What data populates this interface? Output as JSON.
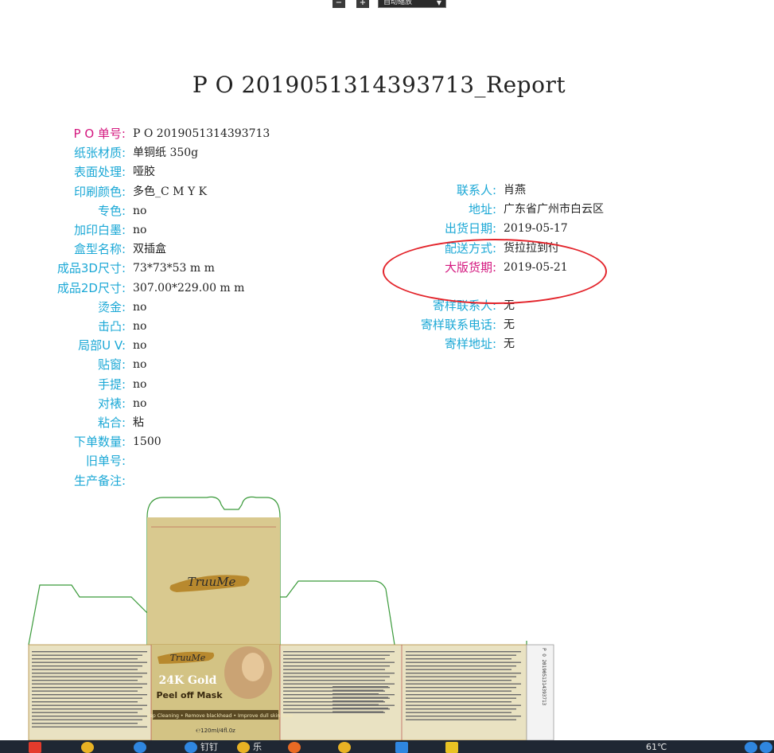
{
  "toolbar": {
    "minus_label": "−",
    "plus_label": "+",
    "zoom_value": "自动缩放"
  },
  "report": {
    "title": "P O 2019051314393713_Report",
    "left_fields": [
      {
        "label": "P O 单号:",
        "value": "P O 2019051314393713",
        "label_color": "pink"
      },
      {
        "label": "纸张材质:",
        "value": "单铜纸 350g"
      },
      {
        "label": "表面处理:",
        "value": "哑胶"
      },
      {
        "label": "印刷颜色:",
        "value": "多色_C M Y K"
      },
      {
        "label": "专色:",
        "value": "no"
      },
      {
        "label": "加印白墨:",
        "value": "no"
      },
      {
        "label": "盒型名称:",
        "value": "双插盒"
      },
      {
        "label": "成品3D尺寸:",
        "value": "73*73*53 m m"
      },
      {
        "label": "成品2D尺寸:",
        "value": "307.00*229.00 m m"
      },
      {
        "label": "烫金:",
        "value": "no"
      },
      {
        "label": "击凸:",
        "value": "no"
      },
      {
        "label": "局部U V:",
        "value": "no"
      },
      {
        "label": "贴窗:",
        "value": "no"
      },
      {
        "label": "手提:",
        "value": "no"
      },
      {
        "label": "对裱:",
        "value": "no"
      },
      {
        "label": "粘合:",
        "value": "粘"
      },
      {
        "label": "下单数量:",
        "value": "1500"
      },
      {
        "label": "旧单号:",
        "value": ""
      },
      {
        "label": "生产备注:",
        "value": ""
      }
    ],
    "right_fields": [
      {
        "label": "联系人:",
        "value": "肖燕"
      },
      {
        "label": "地址:",
        "value": "广东省广州市白云区"
      },
      {
        "label": "出货日期:",
        "value": "2019-05-17"
      },
      {
        "label": "配送方式:",
        "value": "货拉拉到付"
      },
      {
        "label": "大版货期:",
        "value": "2019-05-21",
        "label_color": "pink"
      },
      {
        "label": "寄样联系人:",
        "value": "无"
      },
      {
        "label": "寄样联系电话:",
        "value": "无"
      },
      {
        "label": "寄样地址:",
        "value": "无"
      }
    ]
  },
  "artwork": {
    "brand": "TruuMe",
    "product_line1": "24K Gold",
    "product_line2": "Peel off Mask",
    "features": "• Deep Cleaning • Remove blackhead • Improve dull skin tone",
    "volume": "℮120ml/4fl.0z",
    "side_code": "P O 2019051314393713"
  },
  "taskbar": {
    "temperature": "61℃",
    "item_text_1": "钉钉",
    "item_text_2": "乐"
  },
  "colors": {
    "label_blue": "#1ba8d6",
    "label_pink": "#d4187f",
    "highlight_red": "#e3242b",
    "box_gold": "#d9c98f"
  }
}
